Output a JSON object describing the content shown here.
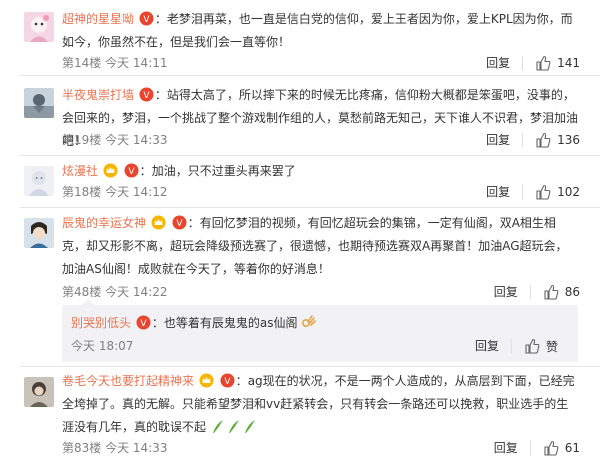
{
  "comments": [
    {
      "user": "超神的星星呦",
      "sep": "：",
      "text": "老梦泪再菜，也一直是信白党的信仰，爱上王者因为你，爱上KPL因为你，而如今，你虽然不在，但是我们会一直等你！",
      "floor": "第14楼",
      "time": "今天 14:11",
      "reply_label": "回复",
      "likes": "141",
      "badges": [
        "red-v-badge"
      ]
    },
    {
      "user": "半夜鬼崇打墙",
      "sep": "：",
      "text": "站得太高了，所以摔下来的时候无比疼痛，信仰粉大概都是笨蛋吧，没事的，会回来的，梦泪，一个挑战了整个游戏制作组的人，莫愁前路无知己，天下谁人不识君，梦泪加油吧！",
      "floor": "第19楼",
      "time": "今天 14:33",
      "reply_label": "回复",
      "likes": "136",
      "badges": [
        "red-v-badge"
      ]
    },
    {
      "user": "炫漫社",
      "sep": "：",
      "text": "加油，只不过重头再来罢了",
      "floor": "第18楼",
      "time": "今天 14:12",
      "reply_label": "回复",
      "likes": "102",
      "badges": [
        "vip-crown-badge",
        "red-v-badge"
      ]
    },
    {
      "user": "辰鬼的幸运女神",
      "sep": "：",
      "text": "有回忆梦泪的视频，有回忆超玩会的集锦，一定有仙阁，双A相生相克，却又形影不离，超玩会降级预选赛了，很遗憾，也期待预选赛双A再聚首！加油AG超玩会，加油AS仙阁！成败就在今天了，等着你的好消息！",
      "floor": "第48楼",
      "time": "今天 14:22",
      "reply_label": "回复",
      "likes": "86",
      "badges": [
        "vip-crown-badge",
        "red-v-badge"
      ],
      "reply": {
        "user": "别哭别低头",
        "sep": "：",
        "text": "也等着有辰鬼鬼的as仙阁",
        "time": "今天 18:07",
        "reply_label": "回复",
        "like_label": "赞",
        "badges": [
          "red-v-badge"
        ]
      }
    },
    {
      "user": "卷毛今天也要打起精神来",
      "sep": "：",
      "text": "ag现在的状况，不是一两个人造成的，从高层到下面，已经完全垮掉了。真的无解。只能希望梦泪和vv赶紧转会，只有转会一条路还可以挽救，职业选手的生涯没有几年，真的耽误不起",
      "floor": "第83楼",
      "time": "今天 14:33",
      "reply_label": "回复",
      "likes": "61",
      "badges": [
        "vip-crown-badge",
        "red-v-badge"
      ]
    }
  ],
  "colors": {
    "username": "#eb7350",
    "meta": "#808080",
    "divider": "#e6e6e6",
    "reply_bg": "#f2f2f5"
  },
  "icons": {
    "like": "thumbs-up-icon",
    "emoji": "ok-hand-emoji",
    "plant": "plant-emoji"
  }
}
